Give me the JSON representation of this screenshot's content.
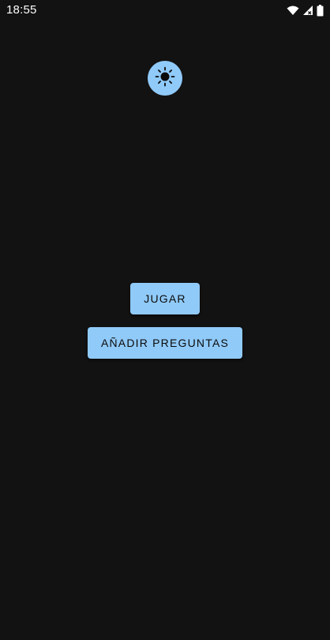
{
  "status_bar": {
    "time": "18:55",
    "icons": [
      "wifi-icon",
      "signal-icon",
      "battery-icon"
    ]
  },
  "theme_toggle": {
    "icon": "sun-icon",
    "color": "#90caf9"
  },
  "menu": {
    "play_label": "JUGAR",
    "add_questions_label": "AÑADIR PREGUNTAS"
  },
  "colors": {
    "background": "#121212",
    "accent": "#90caf9",
    "button_text": "#0b0b0b"
  }
}
